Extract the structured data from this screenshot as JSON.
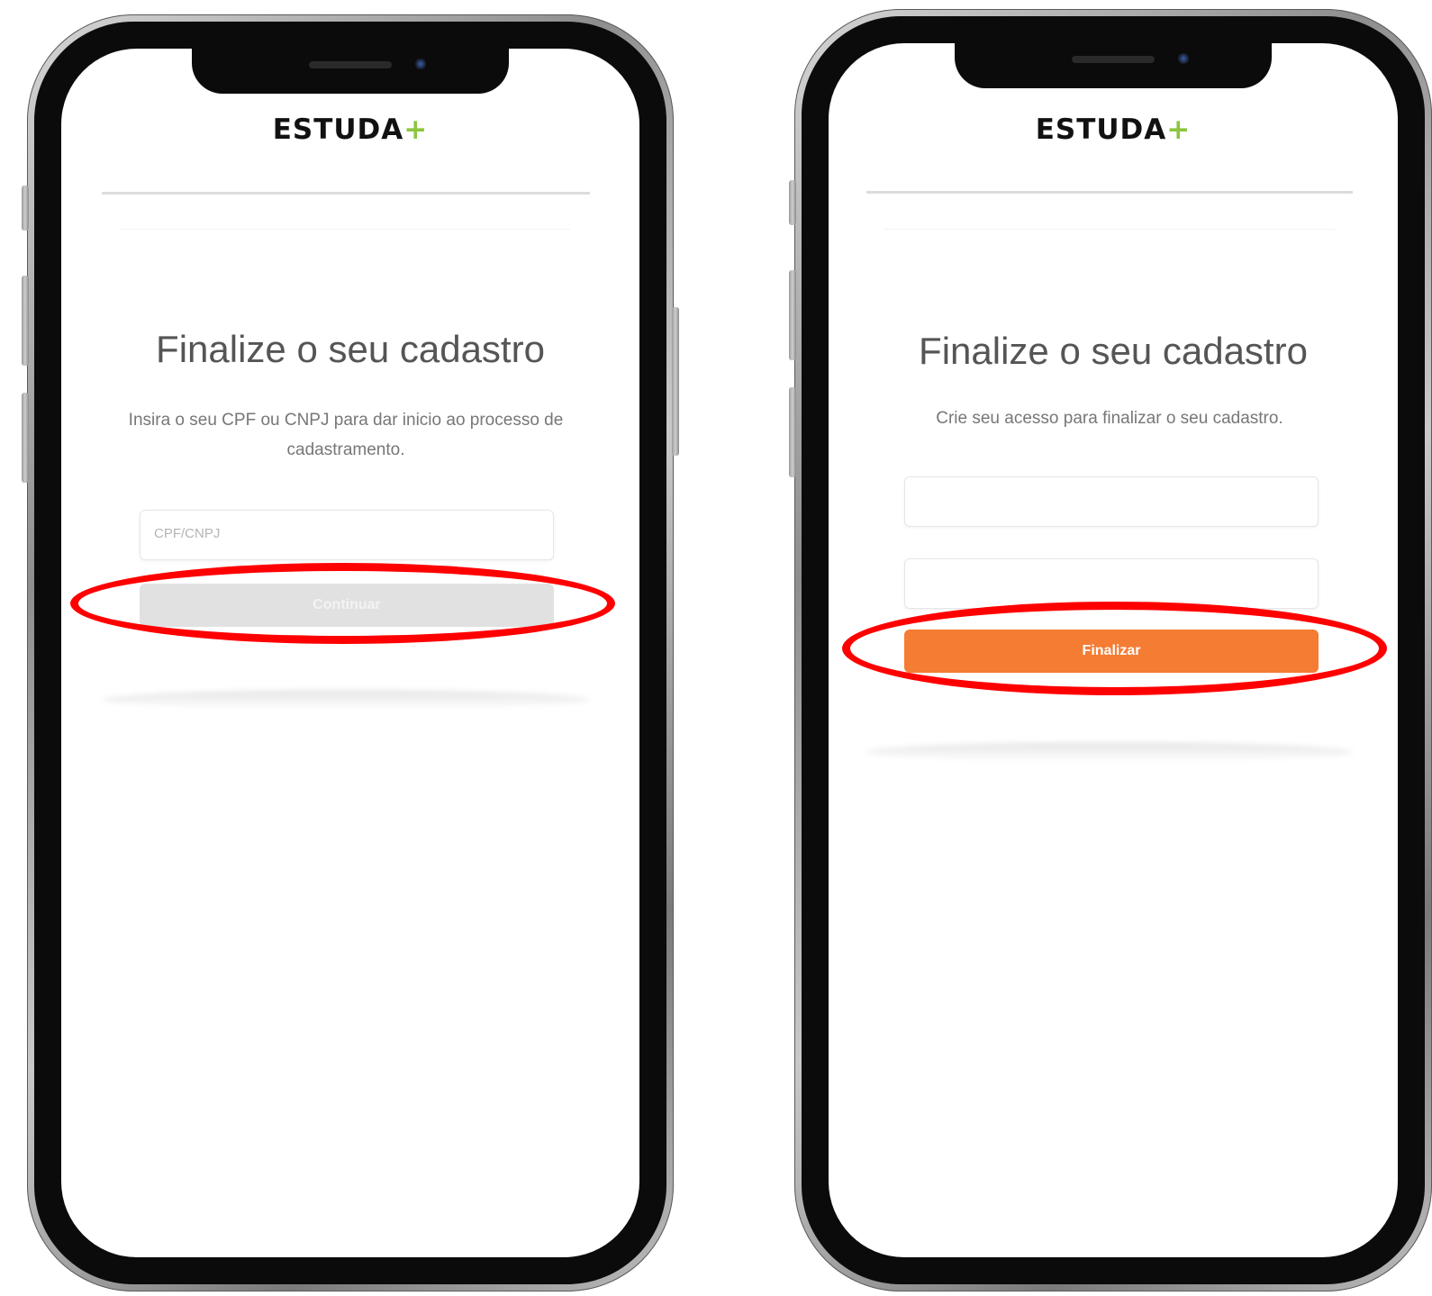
{
  "colors": {
    "brand_plus": "#8cc63f",
    "primary_button": "#f47c33",
    "disabled_button": "#e1e1e1",
    "highlight_annotation": "#ff0000"
  },
  "left_phone": {
    "brand": {
      "name": "ESTUDA",
      "plus": "+"
    },
    "title": "Finalize o seu cadastro",
    "subtitle": "Insira o seu CPF ou CNPJ para dar inicio ao processo de cadastramento.",
    "cpf_field": {
      "placeholder": "CPF/CNPJ",
      "value": ""
    },
    "continue_button": {
      "label": "Continuar",
      "state": "disabled"
    }
  },
  "right_phone": {
    "brand": {
      "name": "ESTUDA",
      "plus": "+"
    },
    "title": "Finalize o seu cadastro",
    "subtitle": "Crie seu acesso para finalizar o seu cadastro.",
    "field_1": {
      "value": ""
    },
    "field_2": {
      "value": ""
    },
    "finish_button": {
      "label": "Finalizar",
      "state": "enabled"
    }
  }
}
